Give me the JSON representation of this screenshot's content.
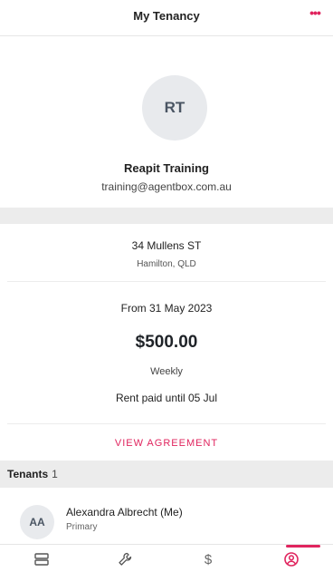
{
  "header": {
    "title": "My Tenancy",
    "more_label": "•••"
  },
  "profile": {
    "initials": "RT",
    "name": "Reapit Training",
    "email": "training@agentbox.com.au"
  },
  "property": {
    "street": "34 Mullens ST",
    "suburb": "Hamilton, QLD"
  },
  "tenancy": {
    "from": "From 31 May 2023",
    "rent": "$500.00",
    "frequency": "Weekly",
    "paid_until": "Rent paid until 05 Jul",
    "view_agreement": "VIEW AGREEMENT"
  },
  "tenants": {
    "label": "Tenants",
    "count": "1",
    "items": [
      {
        "initials": "AA",
        "name": "Alexandra Albrecht (Me)",
        "role": "Primary"
      }
    ]
  },
  "nav": {
    "tabs": [
      {
        "icon": "list-icon",
        "active": false
      },
      {
        "icon": "wrench-icon",
        "active": false
      },
      {
        "icon": "dollar-icon",
        "active": false
      },
      {
        "icon": "profile-icon",
        "active": true
      }
    ]
  },
  "colors": {
    "accent": "#e0245e",
    "divider": "#ececec",
    "avatar_bg": "#e8eaed"
  }
}
